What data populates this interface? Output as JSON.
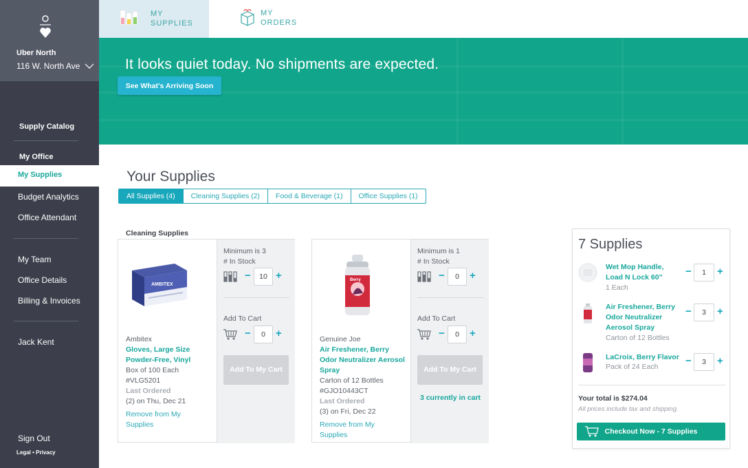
{
  "sidebar": {
    "account_name": "Uber North",
    "account_address": "116 W. North Ave",
    "supply_catalog": "Supply Catalog",
    "my_office": "My Office",
    "items": [
      "My Supplies",
      "Budget Analytics",
      "Office Attendant"
    ],
    "team_items": [
      "My Team",
      "Office Details",
      "Billing & Invoices"
    ],
    "user": "Jack Kent",
    "sign_out": "Sign Out",
    "legal": "Legal • Privacy"
  },
  "tabs": [
    {
      "label": "MY\nSUPPLIES",
      "active": true
    },
    {
      "label": "MY\nORDERS",
      "active": false
    }
  ],
  "hero": {
    "message": "It looks quiet today. No shipments are expected.",
    "button": "See What's Arriving Soon"
  },
  "main": {
    "title": "Your Supplies",
    "filters": [
      "All Supplies (4)",
      "Cleaning Supplies (2)",
      "Food & Beverage (1)",
      "Office Supplies (1)"
    ],
    "section": "Cleaning Supplies"
  },
  "products": [
    {
      "brand": "Ambitex",
      "name": "Gloves, Large Size Powder-Free, Vinyl",
      "pack": "Box of 100 Each",
      "sku": "#VLG5201",
      "last_ordered_label": "Last Ordered",
      "last_ordered": "(2) on Thu, Dec 21",
      "remove": "Remove from My Supplies",
      "minimum": "Minimum is 3",
      "in_stock_label": "# In Stock",
      "in_stock": "10",
      "add_to_cart_label": "Add To Cart",
      "cart_qty": "0",
      "add_button": "Add To My Cart",
      "in_cart_note": ""
    },
    {
      "brand": "Genuine Joe",
      "name": "Air Freshener, Berry Odor Neutralizer Aerosol Spray",
      "pack": "Carton of 12 Bottles",
      "sku": "#GJO10443CT",
      "last_ordered_label": "Last Ordered",
      "last_ordered": "(3) on Fri, Dec 22",
      "remove": "Remove from My Supplies",
      "minimum": "Minimum is 1",
      "in_stock_label": "# In Stock",
      "in_stock": "0",
      "add_to_cart_label": "Add To Cart",
      "cart_qty": "0",
      "add_button": "Add To My Cart",
      "in_cart_note": "3 currently in cart"
    }
  ],
  "cart": {
    "title": "7 Supplies",
    "items": [
      {
        "name": "Wet Mop Handle, Load N Lock 60\"",
        "sub": "1 Each",
        "qty": "1"
      },
      {
        "name": "Air Freshener, Berry Odor Neutralizer Aerosol Spray",
        "sub": "Carton of 12 Bottles",
        "qty": "3"
      },
      {
        "name": "LaCroix, Berry Flavor",
        "sub": "Pack of 24 Each",
        "qty": "3"
      }
    ],
    "total": "Your total is $274.04",
    "tax_note": "All prices include tax and shipping.",
    "checkout": "Checkout Now - 7 Supplies"
  },
  "colors": {
    "accent": "#11a68b",
    "link": "#29a8b6",
    "sidebar": "#3c3f4b"
  }
}
